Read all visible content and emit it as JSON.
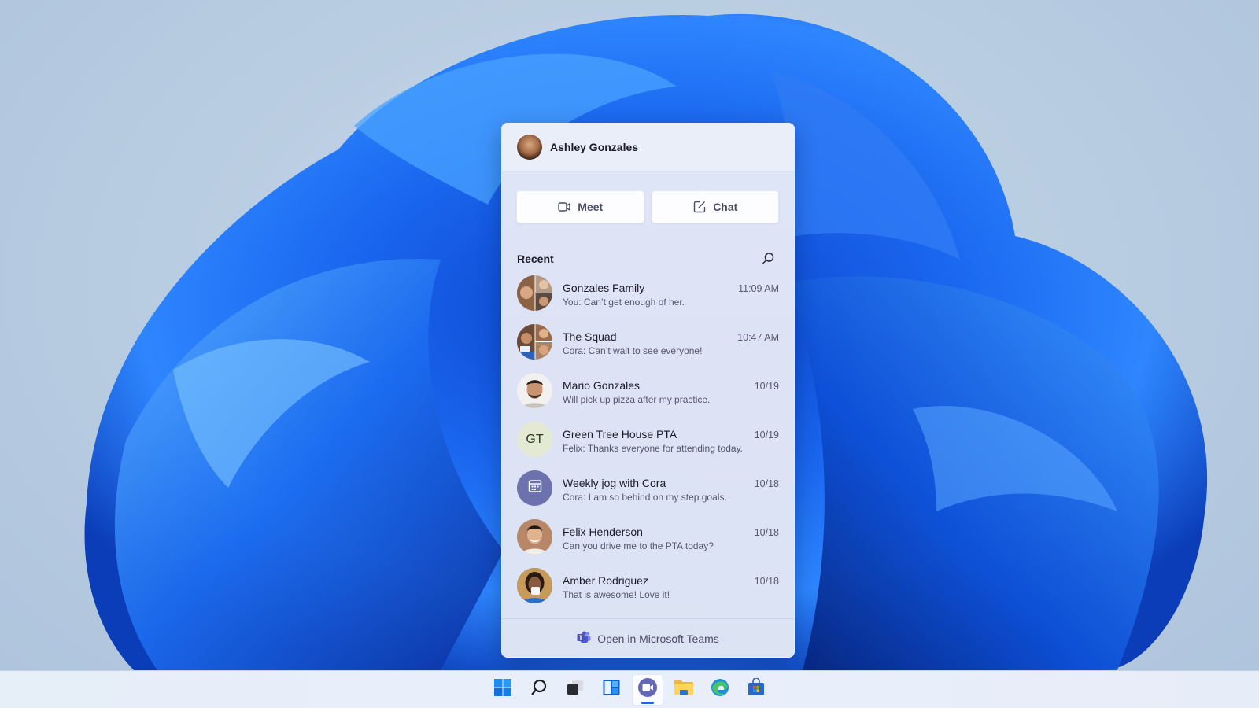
{
  "flyout": {
    "user_name": "Ashley Gonzales",
    "actions": [
      {
        "label": "Meet",
        "icon": "video-camera-icon"
      },
      {
        "label": "Chat",
        "icon": "compose-icon"
      }
    ],
    "recent_label": "Recent",
    "search_icon": "search-icon",
    "conversations": [
      {
        "name": "Gonzales Family",
        "preview": "You: Can’t get enough of her.",
        "time": "11:09 AM",
        "avatar": "group-photo"
      },
      {
        "name": "The Squad",
        "preview": "Cora: Can’t wait to see everyone!",
        "time": "10:47 AM",
        "avatar": "group-photo"
      },
      {
        "name": "Mario Gonzales",
        "preview": "Will pick up pizza after my practice.",
        "time": "10/19",
        "avatar": "photo"
      },
      {
        "name": "Green Tree House PTA",
        "preview": "Felix: Thanks everyone for attending today.",
        "time": "10/19",
        "avatar": "initials",
        "initials": "GT"
      },
      {
        "name": "Weekly jog with Cora",
        "preview": "Cora: I am so behind on my step goals.",
        "time": "10/18",
        "avatar": "calendar-icon"
      },
      {
        "name": "Felix Henderson",
        "preview": "Can you drive me to the PTA today?",
        "time": "10/18",
        "avatar": "photo"
      },
      {
        "name": "Amber Rodriguez",
        "preview": "That is awesome! Love it!",
        "time": "10/18",
        "avatar": "photo"
      }
    ],
    "footer_label": "Open in Microsoft Teams",
    "footer_icon": "teams-icon"
  },
  "taskbar": {
    "items": [
      {
        "name": "start",
        "icon": "windows-logo-icon",
        "active": false
      },
      {
        "name": "search",
        "icon": "search-icon",
        "active": false
      },
      {
        "name": "task-view",
        "icon": "task-view-icon",
        "active": false
      },
      {
        "name": "widgets",
        "icon": "widgets-icon",
        "active": false
      },
      {
        "name": "chat",
        "icon": "teams-chat-icon",
        "active": true
      },
      {
        "name": "file-explorer",
        "icon": "folder-icon",
        "active": false
      },
      {
        "name": "edge",
        "icon": "edge-icon",
        "active": false
      },
      {
        "name": "store",
        "icon": "store-icon",
        "active": false
      }
    ]
  },
  "colors": {
    "accent": "#2a64c8",
    "teams_purple": "#6264a7",
    "wallpaper_blue": "#1a5de0"
  }
}
